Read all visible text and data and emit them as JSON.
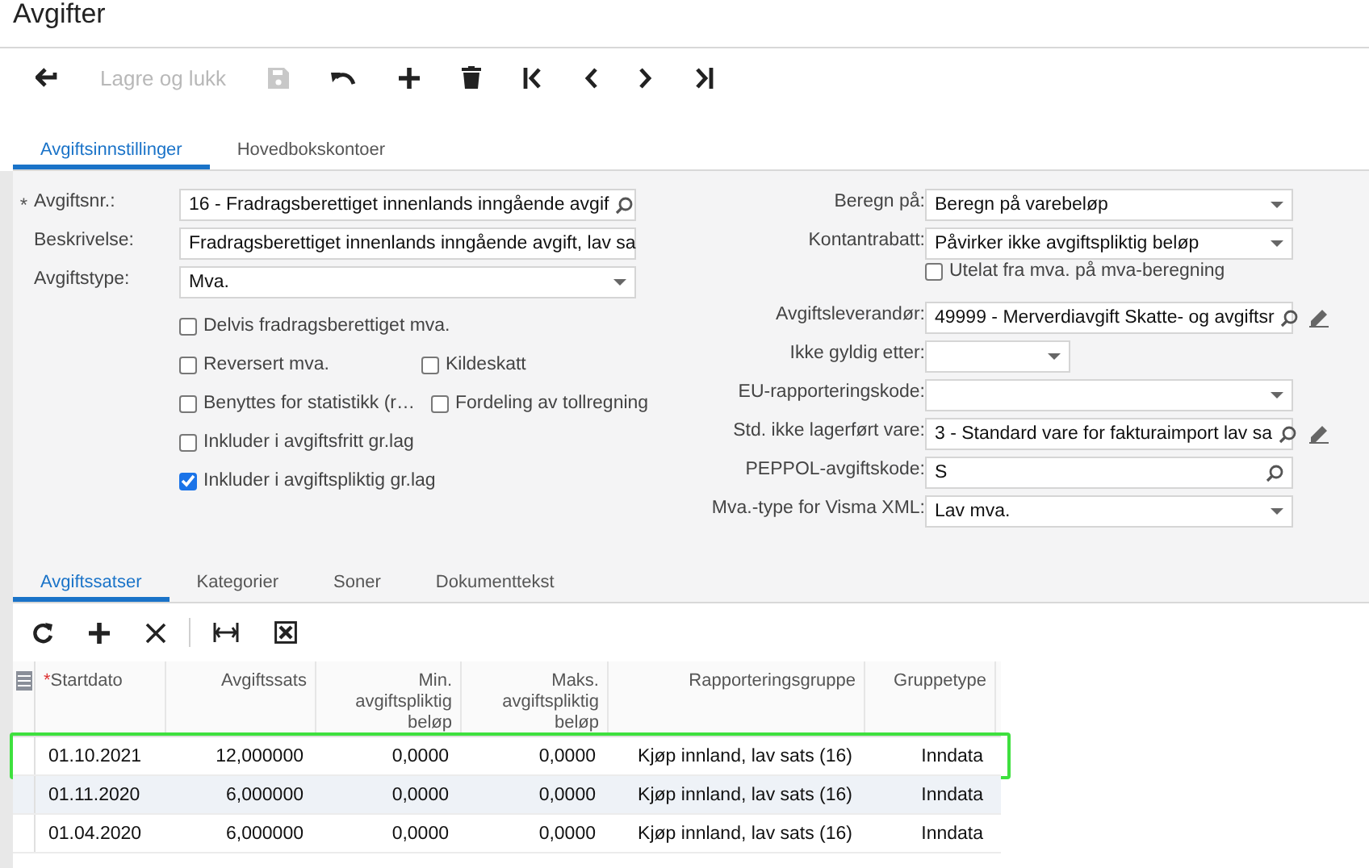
{
  "title": "Avgifter",
  "toolbar": {
    "save_and_close": {
      "label": "Lagre og lukk",
      "disabled": true
    },
    "save_disabled": true
  },
  "tabs": [
    {
      "label": "Avgiftsinnstillinger",
      "selected": true
    },
    {
      "label": "Hovedbokskontoer",
      "selected": false
    }
  ],
  "left_fields": [
    {
      "label": "Avgiftsnr.:",
      "required_mark": "*",
      "kind": "lookup",
      "value": "16 - Fradragsberettiget innenlands inngående avgif"
    },
    {
      "label": "Beskrivelse:",
      "kind": "text",
      "value": "Fradragsberettiget innenlands inngående avgift, lav sa"
    },
    {
      "label": "Avgiftstype:",
      "kind": "select",
      "value": "Mva."
    }
  ],
  "checkbox_rows": [
    [
      {
        "label": "Delvis fradragsberettiget mva.",
        "checked": false
      }
    ],
    [
      {
        "label": "Reversert mva.",
        "checked": false
      },
      {
        "label": "Kildeskatt",
        "checked": false
      }
    ],
    [
      {
        "label": "Benyttes for statistikk (r…",
        "checked": false
      },
      {
        "label": "Fordeling av tollregning",
        "checked": false
      }
    ],
    [
      {
        "label": "Inkluder i avgiftsfritt gr.lag",
        "checked": false
      }
    ],
    [
      {
        "label": "Inkluder i avgiftspliktig gr.lag",
        "checked": true
      }
    ]
  ],
  "right_fields": [
    {
      "label": "Beregn på:",
      "kind": "select",
      "value": "Beregn på varebeløp",
      "edit": false
    },
    {
      "label": "Kontantrabatt:",
      "kind": "select",
      "value": "Påvirker ikke avgiftspliktig beløp",
      "edit": false,
      "checkbox": {
        "label": "Utelat fra mva. på mva-beregning",
        "checked": false
      }
    },
    {
      "label": "Avgiftsleverandør:",
      "kind": "lookup",
      "value": "49999 - Merverdiavgift Skatte- og avgiftsr",
      "edit": true
    },
    {
      "label": "Ikke gyldig etter:",
      "kind": "date",
      "edit": false
    },
    {
      "label": "EU-rapporteringskode:",
      "kind": "select",
      "edit": false
    },
    {
      "label": "Std. ikke lagerført vare:",
      "kind": "lookup",
      "value": "3 - Standard vare for fakturaimport lav sa",
      "edit": true
    },
    {
      "label": "PEPPOL-avgiftskode:",
      "kind": "lookup",
      "value": "S",
      "edit": false
    },
    {
      "label": "Mva.-type for Visma XML:",
      "kind": "select",
      "value": "Lav mva.",
      "edit": false
    }
  ],
  "detail_tabs": [
    {
      "label": "Avgiftssatser",
      "selected": true
    },
    {
      "label": "Kategorier",
      "selected": false
    },
    {
      "label": "Soner",
      "selected": false
    },
    {
      "label": "Dokumenttekst",
      "selected": false
    }
  ],
  "table": {
    "columns": [
      {
        "label": "Startdato",
        "required_mark": "*"
      },
      {
        "label": "Avgiftssats"
      },
      {
        "label": "Min.\navgiftspliktig\nbeløp"
      },
      {
        "label": "Maks.\navgiftspliktig\nbeløp"
      },
      {
        "label": "Rapporteringsgruppe"
      },
      {
        "label": "Gruppetype"
      }
    ],
    "rows": [
      {
        "cells": [
          "01.10.2021",
          "12,000000",
          "0,0000",
          "0,0000",
          "Kjøp innland, lav sats (16)",
          "Inndata"
        ],
        "highlighted": true
      },
      {
        "cells": [
          "01.11.2020",
          "6,000000",
          "0,0000",
          "0,0000",
          "Kjøp innland, lav sats (16)",
          "Inndata"
        ],
        "highlighted": false
      },
      {
        "cells": [
          "01.04.2020",
          "6,000000",
          "0,0000",
          "0,0000",
          "Kjøp innland, lav sats (16)",
          "Inndata"
        ],
        "highlighted": false
      }
    ]
  }
}
